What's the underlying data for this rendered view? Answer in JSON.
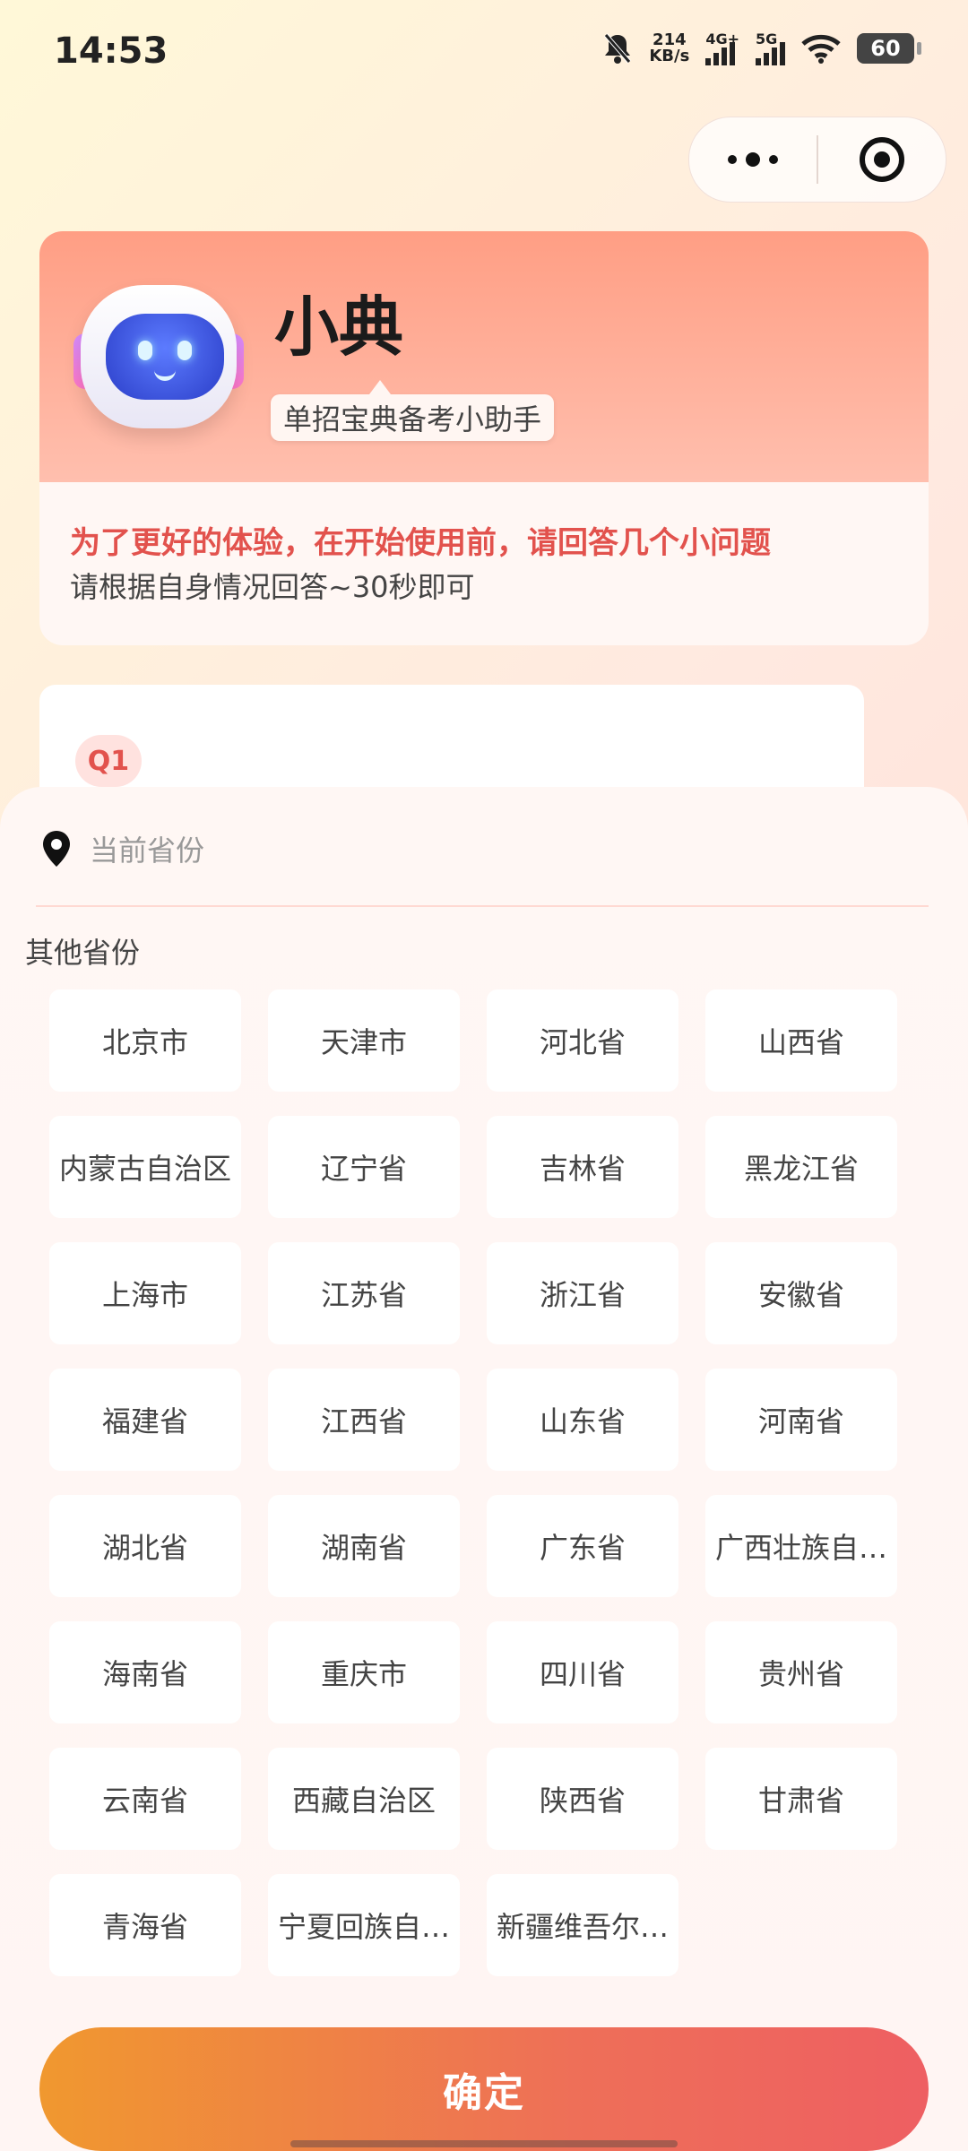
{
  "status_bar": {
    "time": "14:53",
    "net_speed_value": "214",
    "net_speed_unit": "KB/s",
    "signal1_label": "4G+",
    "signal2_label": "5G",
    "battery": "60"
  },
  "intro": {
    "bot_name": "小典",
    "bot_tagline": "单招宝典备考小助手",
    "headline": "为了更好的体验，在开始使用前，请回答几个小问题",
    "subline": "请根据自身情况回答~30秒即可"
  },
  "question": {
    "badge": "Q1"
  },
  "sheet": {
    "current_province_placeholder": "当前省份",
    "other_provinces_label": "其他省份",
    "provinces": [
      "北京市",
      "天津市",
      "河北省",
      "山西省",
      "内蒙古自治区",
      "辽宁省",
      "吉林省",
      "黑龙江省",
      "上海市",
      "江苏省",
      "浙江省",
      "安徽省",
      "福建省",
      "江西省",
      "山东省",
      "河南省",
      "湖北省",
      "湖南省",
      "广东省",
      "广西壮族自…",
      "海南省",
      "重庆市",
      "四川省",
      "贵州省",
      "云南省",
      "西藏自治区",
      "陕西省",
      "甘肃省",
      "青海省",
      "宁夏回族自…",
      "新疆维吾尔…"
    ],
    "confirm_label": "确定"
  },
  "colors": {
    "accent": "#e2524d",
    "button_start": "#f0982f",
    "button_end": "#ee5f62"
  }
}
